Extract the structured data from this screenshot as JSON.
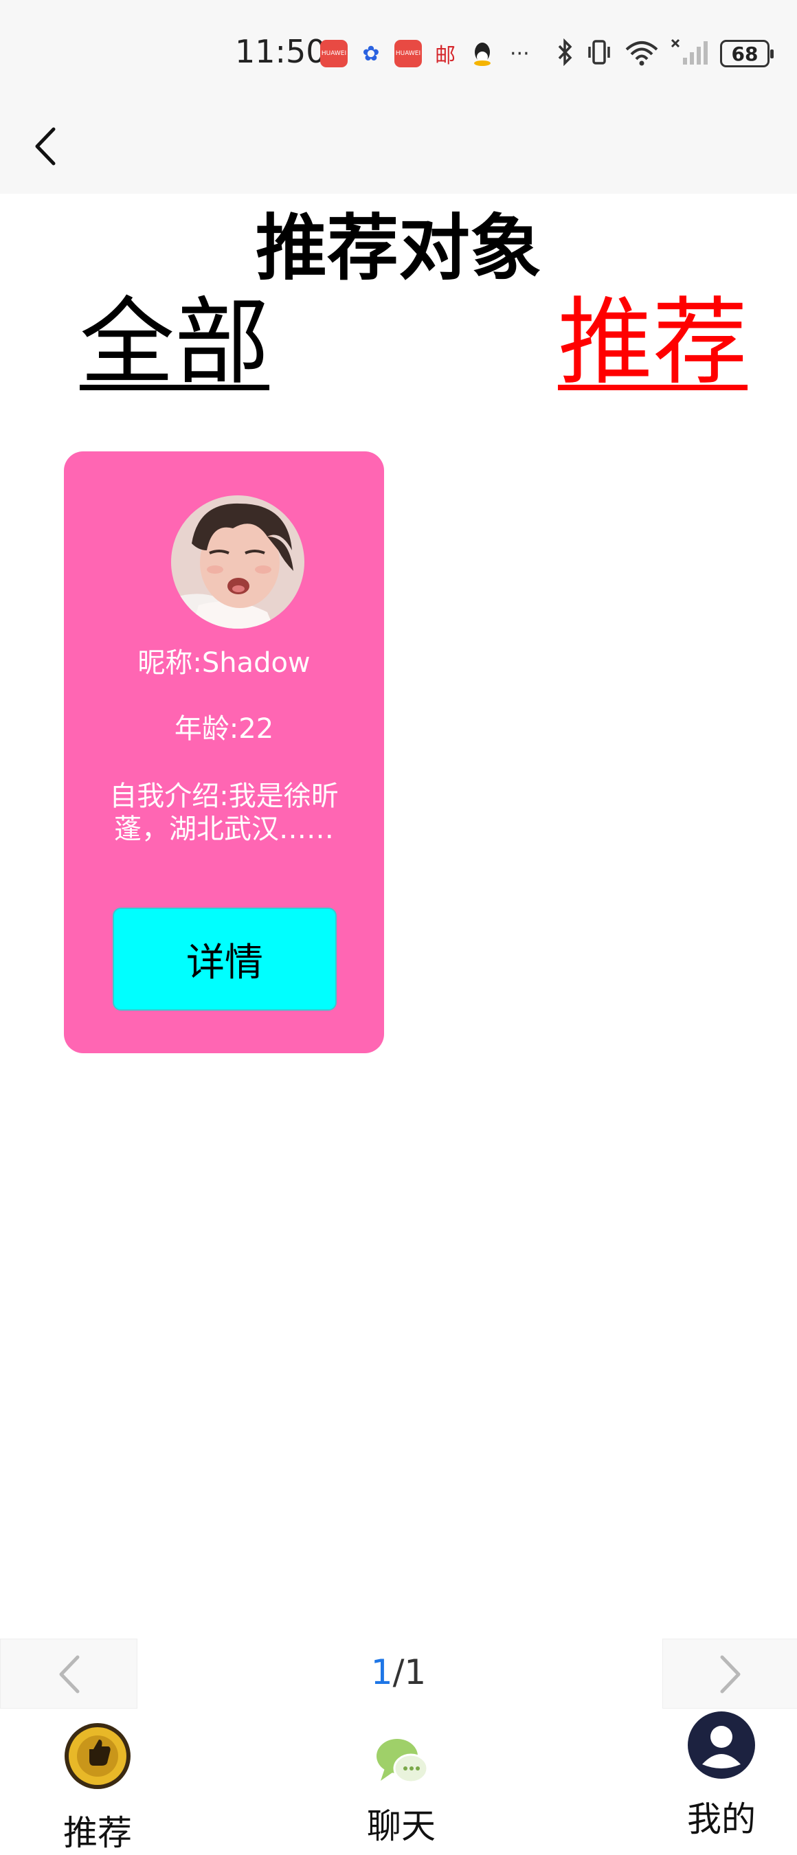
{
  "status_bar": {
    "time": "11:50",
    "battery": "68",
    "notification_icons": [
      "huawei-icon",
      "baidu-icon",
      "huawei-icon",
      "postal-icon",
      "qq-icon",
      "more-icon"
    ]
  },
  "page": {
    "title": "推荐对象"
  },
  "tabs": {
    "all": "全部",
    "recommend": "推荐"
  },
  "card": {
    "nickname": "昵称:Shadow",
    "age": "年龄:22",
    "intro": "自我介绍:我是徐昕蓬，湖北武汉……",
    "detail_button": "详情"
  },
  "pager": {
    "current": "1",
    "separator": "/",
    "total": "1"
  },
  "bottom_nav": {
    "recommend": "推荐",
    "chat": "聊天",
    "mine": "我的"
  },
  "colors": {
    "card_bg": "#ff66b3",
    "detail_button_bg": "#00ffff",
    "tab_active": "#ff0000",
    "page_current": "#1e76e6"
  }
}
